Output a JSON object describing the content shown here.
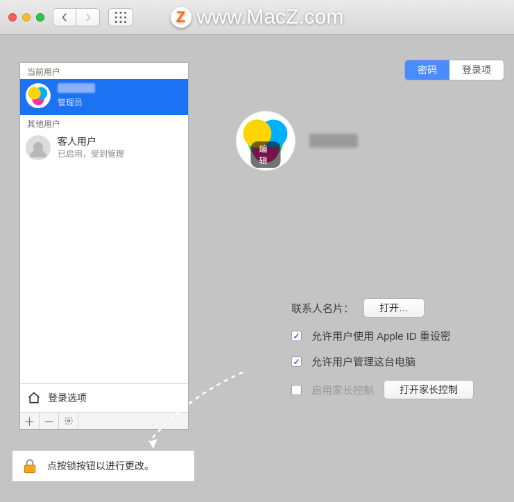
{
  "watermark": {
    "text": "www.MacZ.com",
    "badge": "Z"
  },
  "sidebar": {
    "current_header": "当前用户",
    "other_header": "其他用户",
    "selected": {
      "role": "管理员"
    },
    "guest": {
      "name": "客人用户",
      "sub": "已启用，受到管理"
    },
    "login_options": "登录选项"
  },
  "tabs": {
    "password": "密码",
    "login_items": "登录项"
  },
  "profile": {
    "edit": "编辑"
  },
  "form": {
    "contact_label": "联系人名片：",
    "open_button": "打开…",
    "allow_appleid": "允许用户使用 Apple ID 重设密",
    "allow_admin": "允许用户管理这台电脑",
    "parental_enable": "启用家长控制",
    "parental_button": "打开家长控制"
  },
  "lockbar": "点按锁按钮以进行更改。"
}
